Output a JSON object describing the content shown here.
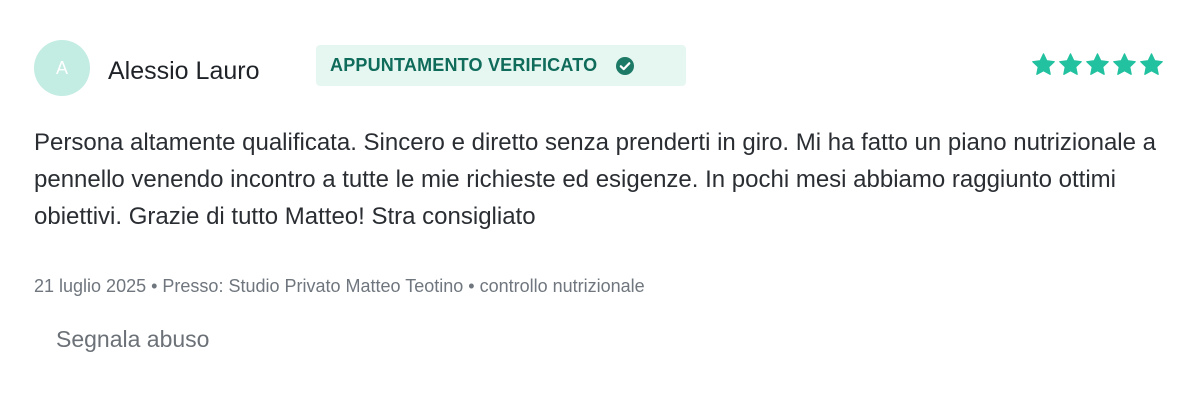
{
  "review": {
    "avatar_initial": "A",
    "author_name": "Alessio Lauro",
    "badge": {
      "label": "APPUNTAMENTO VERIFICATO",
      "icon": "check-circle-icon"
    },
    "rating": {
      "value": 5,
      "max": 5,
      "icon": "star-icon",
      "color": "#22c1a0"
    },
    "text": "Persona altamente qualificata. Sincero e diretto senza prenderti in giro. Mi ha fatto un piano nutrizionale a pennello venendo incontro a tutte le mie richieste ed esigenze. In pochi mesi abbiamo raggiunto ottimi obiettivi. Grazie di tutto Matteo! Stra consigliato",
    "meta": {
      "date": "21 luglio 2025",
      "separator": "•",
      "location": "Presso: Studio Privato Matteo Teotino",
      "service": "controllo nutrizionale"
    },
    "report_link": "Segnala abuso"
  },
  "colors": {
    "accent": "#22c1a0",
    "badge_bg": "#e6f7f2",
    "badge_text": "#0f6b5a",
    "avatar_bg": "#c3ece3"
  }
}
